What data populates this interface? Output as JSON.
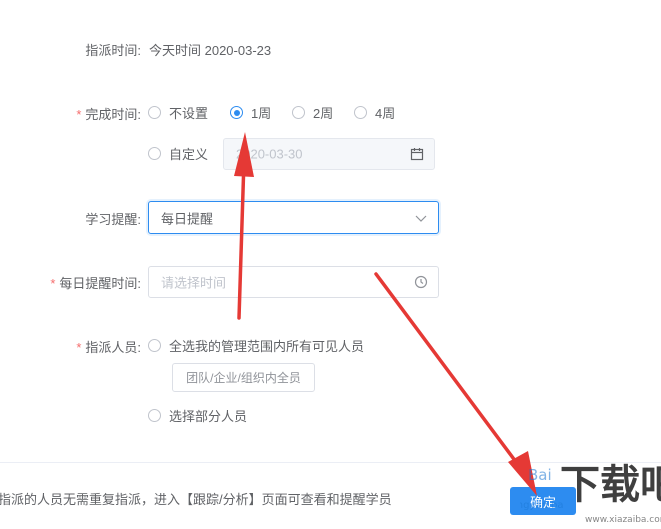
{
  "assign_time": {
    "label": "指派时间:",
    "value": "今天时间 2020-03-23"
  },
  "complete_time": {
    "label": "完成时间:",
    "options": [
      "不设置",
      "1周",
      "2周",
      "4周"
    ],
    "selected": "1周",
    "custom_label": "自定义",
    "custom_date": "2020-03-30"
  },
  "study_reminder": {
    "label": "学习提醒:",
    "value": "每日提醒"
  },
  "daily_reminder_time": {
    "label": "每日提醒时间:",
    "placeholder": "请选择时间"
  },
  "assignees": {
    "label": "指派人员:",
    "option_all": "全选我的管理范围内所有可见人员",
    "all_tag": "团队/企业/组织内全员",
    "option_partial": "选择部分人员"
  },
  "footer": {
    "notice": "指派的人员无需重复指派，进入【跟踪/分析】页面可查看和提醒学员",
    "confirm": "确定"
  },
  "colors": {
    "accent": "#2d8cf0",
    "required": "#f56c6c",
    "arrow": "#e53935"
  }
}
